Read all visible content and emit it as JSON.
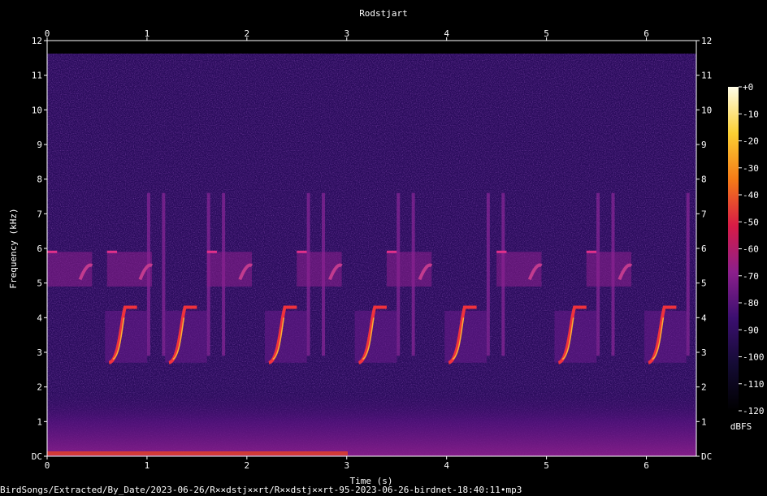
{
  "chart_data": {
    "type": "heatmap",
    "title": "Rodstjart",
    "xlabel": "Time (s)",
    "ylabel": "Frequency (kHz)",
    "xlim": [
      0,
      6.5
    ],
    "ylim": [
      0,
      12
    ],
    "x_ticks": [
      "0",
      "1",
      "2",
      "3",
      "4",
      "5",
      "6"
    ],
    "y_ticks": [
      "DC",
      "1",
      "2",
      "3",
      "4",
      "5",
      "6",
      "7",
      "8",
      "9",
      "10",
      "11",
      "12"
    ],
    "colorbar": {
      "label": "dBFS",
      "range": [
        -120,
        0
      ],
      "ticks": [
        "+0",
        "-10",
        "-20",
        "-30",
        "-40",
        "-50",
        "-60",
        "-70",
        "-80",
        "-90",
        "-100",
        "-110",
        "-120"
      ],
      "colors": [
        "#000000",
        "#140b34",
        "#3b0f70",
        "#8c1f8c",
        "#d81b46",
        "#f57b17",
        "#fbd033",
        "#fffde8"
      ]
    },
    "grid": false,
    "background_color": "#2a0c5c",
    "song_phrases_start_s": [
      0.0,
      0.6,
      1.6,
      2.5,
      3.4,
      4.5,
      5.4
    ],
    "sweep_freq_khz": [
      2.7,
      4.3
    ],
    "upper_note_freq_khz": [
      4.9,
      5.9
    ],
    "low_freq_noise_khz": [
      0,
      2
    ]
  },
  "footer": {
    "filename": "BirdSongs/Extracted/By_Date/2023-06-26/R××dstj××rt/R××dstj××rt-95-2023-06-26-birdnet-18:40:11•mp3"
  }
}
